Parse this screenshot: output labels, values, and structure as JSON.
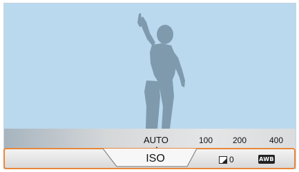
{
  "iso_scale": {
    "options": [
      "AUTO",
      "100",
      "200",
      "400"
    ],
    "selected": "AUTO"
  },
  "menu": {
    "iso_label": "ISO",
    "ev_value": "0",
    "wb_badge": "AWB"
  },
  "colors": {
    "sky": "#bad9ef",
    "silhouette": "#7f9aad",
    "highlight_border": "#e8873b"
  },
  "icons": {
    "ev": "exposure-compensation-icon",
    "wb": "awb-icon"
  }
}
